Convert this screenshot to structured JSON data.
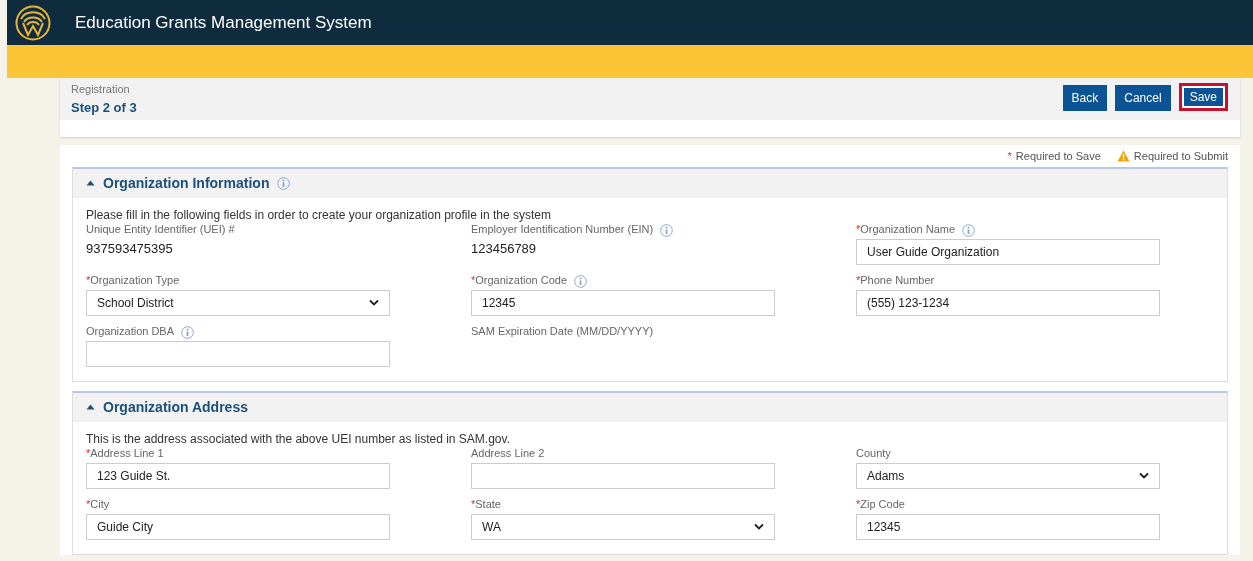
{
  "header": {
    "title": "Education Grants Management System"
  },
  "step": {
    "label": "Registration",
    "title": "Step 2 of 3"
  },
  "buttons": [
    {
      "label": "Back",
      "highlighted": false
    },
    {
      "label": "Cancel",
      "highlighted": false
    },
    {
      "label": "Save",
      "highlighted": true
    }
  ],
  "legend": [
    {
      "kind": "asterisk",
      "mark": "*",
      "text": "Required to Save"
    },
    {
      "kind": "warning",
      "text": "Required to Submit"
    }
  ],
  "sections": [
    {
      "title": "Organization Information",
      "info": true,
      "expanded": true,
      "description": "Please fill in the following fields in order to create your organization profile in the system",
      "fields": [
        {
          "kind": "readonly",
          "label": "Unique Entity Identifier (UEI) #",
          "info": false,
          "value": "937593475395"
        },
        {
          "kind": "readonly",
          "label": "Employer Identification Number (EIN)",
          "info": true,
          "value": "123456789"
        },
        {
          "kind": "input",
          "mark": "*",
          "label": "Organization Name",
          "info": true,
          "value": "User Guide Organization"
        },
        {
          "kind": "select",
          "mark": "*",
          "label": "Organization Type",
          "info": false,
          "value": "School District"
        },
        {
          "kind": "input",
          "mark": "*",
          "label": "Organization Code",
          "info": true,
          "value": "12345"
        },
        {
          "kind": "input",
          "mark": "*",
          "label": "Phone Number",
          "info": false,
          "value": "(555) 123-1234"
        },
        {
          "kind": "input",
          "label": "Organization DBA",
          "info": true
        },
        {
          "kind": "label",
          "label": "SAM Expiration Date (MM/DD/YYYY)",
          "info": false
        }
      ]
    },
    {
      "title": "Organization Address",
      "info": false,
      "expanded": true,
      "description": "This is the address associated with the above UEI number as listed in SAM.gov.",
      "fields": [
        {
          "kind": "input",
          "mark": "*",
          "label": "Address Line 1",
          "info": false,
          "value": "123 Guide St."
        },
        {
          "kind": "input",
          "label": "Address Line 2",
          "info": false
        },
        {
          "kind": "select",
          "label": "County",
          "info": false,
          "value": "Adams"
        },
        {
          "kind": "input",
          "mark": "*",
          "label": "City",
          "info": false,
          "value": "Guide City"
        },
        {
          "kind": "select",
          "mark": "*",
          "label": "State",
          "info": false,
          "value": "WA"
        },
        {
          "kind": "input",
          "mark": "*",
          "label": "Zip Code",
          "info": false,
          "value": "12345"
        }
      ]
    }
  ]
}
